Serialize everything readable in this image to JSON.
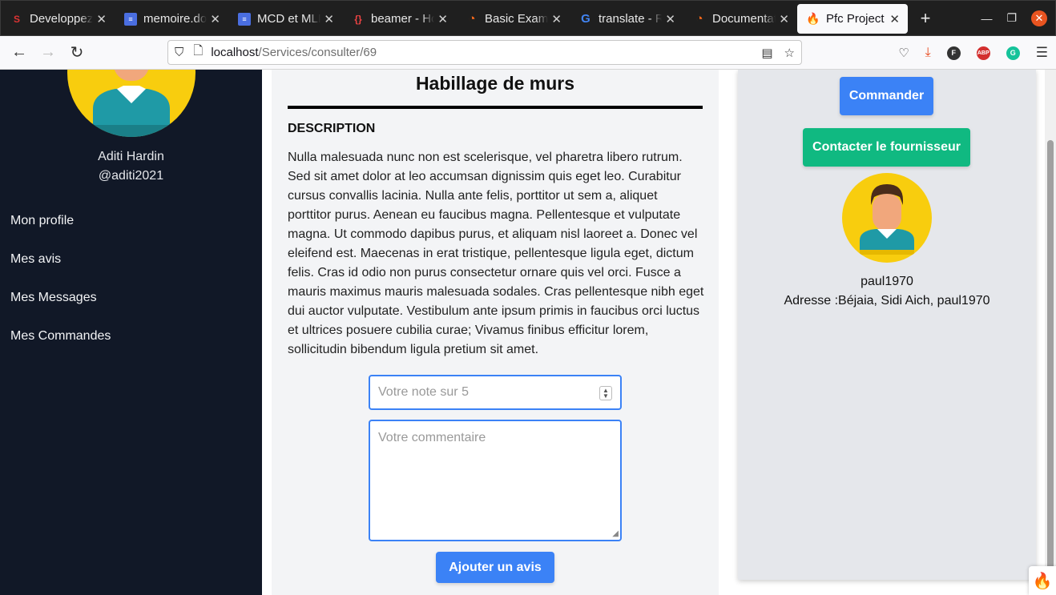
{
  "browser": {
    "tabs": [
      {
        "title": "Developpez.",
        "icon": "developpez-icon",
        "active": false
      },
      {
        "title": "memoire.doc",
        "icon": "google-docs-icon",
        "active": false
      },
      {
        "title": "MCD et MLD",
        "icon": "google-docs-icon",
        "active": false
      },
      {
        "title": "beamer - How",
        "icon": "overleaf-icon",
        "active": false
      },
      {
        "title": "Basic Exampl",
        "icon": "gitlab-icon",
        "active": false
      },
      {
        "title": "translate - Re",
        "icon": "google-icon",
        "active": false
      },
      {
        "title": "Documentati",
        "icon": "gitlab-icon",
        "active": false
      },
      {
        "title": "Pfc Project",
        "icon": "codeigniter-icon",
        "active": true
      }
    ],
    "url_host": "localhost",
    "url_path": "/Services/consulter/69"
  },
  "sidebar": {
    "user_name": "Aditi Hardin",
    "user_handle": "@aditi2021",
    "items": [
      {
        "label": "Mon profile"
      },
      {
        "label": "Mes avis"
      },
      {
        "label": "Mes Messages"
      },
      {
        "label": "Mes Commandes"
      }
    ]
  },
  "service": {
    "title": "Habillage de murs",
    "description_label": "DESCRIPTION",
    "description": "Nulla malesuada nunc non est scelerisque, vel pharetra libero rutrum. Sed sit amet dolor at leo accumsan dignissim quis eget leo. Curabitur cursus convallis lacinia. Nulla ante felis, porttitor ut sem a, aliquet porttitor purus. Aenean eu faucibus magna. Pellentesque et vulputate magna. Ut commodo dapibus purus, et aliquam nisl laoreet a. Donec vel eleifend est. Maecenas in erat tristique, pellentesque ligula eget, dictum felis. Cras id odio non purus consectetur ornare quis vel orci. Fusce a mauris maximus mauris malesuada sodales. Cras pellentesque nibh eget dui auctor vulputate. Vestibulum ante ipsum primis in faucibus orci luctus et ultrices posuere cubilia curae; Vivamus finibus efficitur lorem, sollicitudin bibendum ligula pretium sit amet."
  },
  "review_form": {
    "note_placeholder": "Votre note sur 5",
    "comment_placeholder": "Votre commentaire",
    "submit_label": "Ajouter un avis"
  },
  "provider": {
    "order_label": "Commander",
    "contact_label": "Contacter le fournisseur",
    "username": "paul1970",
    "address": "Adresse :Béjaia, Sidi Aich, paul1970"
  },
  "colors": {
    "sidebar_bg": "#111827",
    "primary": "#3b82f6",
    "success": "#10b981",
    "avatar_bg": "#f8cd0e"
  }
}
